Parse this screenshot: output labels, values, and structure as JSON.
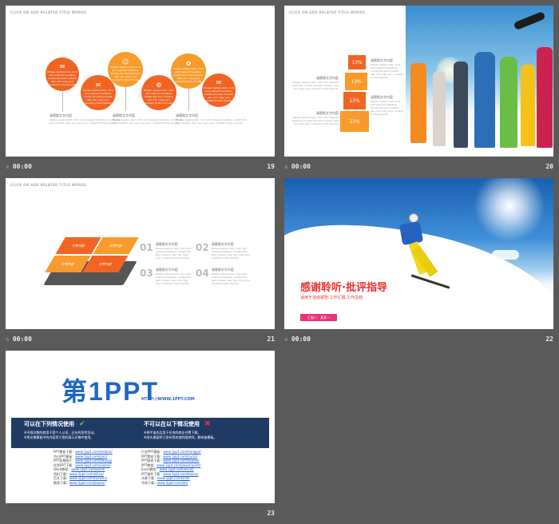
{
  "slides": [
    {
      "number": "19",
      "time": "00:00",
      "header": "CLICK ON ADD RELATED TITLE WORDS",
      "circles": [
        {
          "icon": "✉",
          "text": "Please replace text, click add relevant headline, modify the text content, also can copy your content to this directly."
        },
        {
          "icon": "✉",
          "text": "Please replace text, click add relevant headline, modify the text content, also can copy your content to this directly."
        },
        {
          "icon": "☺",
          "text": "Please replace text, click add relevant headline, modify the text content, also can copy your content to this directly."
        },
        {
          "icon": "⚙",
          "text": "Please replace text, click add relevant headline, modify the text content, also can copy your content to this directly."
        },
        {
          "icon": "✿",
          "text": "Please replace text, click add relevant headline, modify the text content, also can copy your content to this directly."
        },
        {
          "icon": "✉",
          "text": "Please replace text, click add relevant headline, modify the text content, also can copy your content to this directly."
        }
      ],
      "captions": [
        {
          "title": "请替换文字内容",
          "body": "Please replace text, click add relevant headline, modify the text content, also can copy your content to this directly."
        },
        {
          "title": "请替换文字内容",
          "body": "Please replace text, click add relevant headline, modify the text content, also can copy your content to this directly."
        },
        {
          "title": "请替换文字内容",
          "body": "Please replace text, click add relevant headline, modify the text content, also can copy your content to this directly."
        }
      ]
    },
    {
      "number": "20",
      "time": "00:00",
      "header": "CLICK ON ADD RELATED TITLE WORDS",
      "cubes": [
        "13%",
        "13%",
        "13%",
        "13%"
      ],
      "left_text": [
        {
          "title": "请替换文字内容",
          "body": "Please replace text, click add relevant headline, modify the text content, also can copy your content to this directly."
        },
        {
          "title": "请替换文字内容",
          "body": "Please replace text, click add relevant headline, modify the text content, also can copy your content to this directly."
        }
      ],
      "right_text": [
        {
          "title": "请替换文字内容",
          "body": "Please replace text, click add relevant headline, modify the text content, also can copy your content to this directly."
        },
        {
          "title": "请替换文字内容",
          "body": "Please replace text, click add relevant headline, modify the text content, also can copy your content to this directly."
        }
      ]
    },
    {
      "number": "21",
      "time": "00:00",
      "header": "CLICK ON ADD RELATED TITLE WORDS",
      "blocks": [
        "文字内容",
        "文字内容",
        "文字内容",
        "文字内容"
      ],
      "items": [
        {
          "num": "01",
          "title": "请替换文字内容",
          "body": "Please replace text, click add relevant headline, modify the text content, also can copy your content to this directly."
        },
        {
          "num": "02",
          "title": "请替换文字内容",
          "body": "Please replace text, click add relevant headline, modify the text content, also can copy your content to this directly."
        },
        {
          "num": "03",
          "title": "请替换文字内容",
          "body": "Please replace text, click add relevant headline, modify the text content, also can copy your content to this directly."
        },
        {
          "num": "04",
          "title": "请替换文字内容",
          "body": "Please replace text, click add relevant headline, modify the text content, also can copy your content to this directly."
        }
      ]
    },
    {
      "number": "22",
      "time": "00:00",
      "title": "感谢聆听·批评指导",
      "subtitle": "适用于活动报告·工作汇报·工作总结",
      "reporter": "汇报人：某某一"
    },
    {
      "number": "23",
      "logo_main": "第1PPT",
      "logo_url": "HTTP://WWW.1PPT.COM",
      "can_title": "可以在下列情况使用",
      "can_items": [
        "※不限次数的商用于您个人公司、企业的宣传活动。",
        "※将文稿模板中的内容用于您的演示文稿中使用。"
      ],
      "cannot_title": "不可以在以下情况使用",
      "cannot_items": [
        "※将手该作品用于任何的商业付费下载。",
        "※改头换面转订发布到其他的图库网，影响该模板。"
      ],
      "links_left": [
        {
          "label": "PPT模板下载：",
          "url": "www.1ppt.com/moban/"
        },
        {
          "label": "节日PPT模板：",
          "url": "www.1ppt.com/jieri/"
        },
        {
          "label": "PPT背景图片：",
          "url": "www.1ppt.com/beijing/"
        },
        {
          "label": "优秀PPT下载：",
          "url": "www.1ppt.com/xiazai/"
        },
        {
          "label": "Word教程：",
          "url": "www.1ppt.com/word/"
        },
        {
          "label": "资料下载：",
          "url": "www.1ppt.com/ziliao/"
        },
        {
          "label": "范文下载：",
          "url": "www.1ppt.com/fanwen/"
        },
        {
          "label": "教案下载：",
          "url": "www.1ppt.com/jiaoan/"
        }
      ],
      "links_right": [
        {
          "label": "行业PPT模板：",
          "url": "www.1ppt.com/hangye/"
        },
        {
          "label": "PPT素材下载：",
          "url": "www.1ppt.com/sucai/"
        },
        {
          "label": "PPT图表下载：",
          "url": "www.1ppt.com/tubiao/"
        },
        {
          "label": "PPT教程：",
          "url": "www.1ppt.com/powerpoint/"
        },
        {
          "label": "Excel教程：",
          "url": "www.1ppt.com/excel/"
        },
        {
          "label": "PPT课件下载：",
          "url": "www.1ppt.com/kejian/"
        },
        {
          "label": "试卷下载：",
          "url": "www.1ppt.com/shiti/"
        },
        {
          "label": "字体下载：",
          "url": "www.1ppt.com/ziti/"
        }
      ]
    }
  ],
  "colors": {
    "orange": "#f26422",
    "orange_light": "#f89b2c",
    "navy": "#1f3b64",
    "red": "#e8322e",
    "pink": "#e8327c"
  },
  "icons": {
    "time": "star-clock-icon",
    "check": "check-icon",
    "cross": "cross-icon"
  }
}
